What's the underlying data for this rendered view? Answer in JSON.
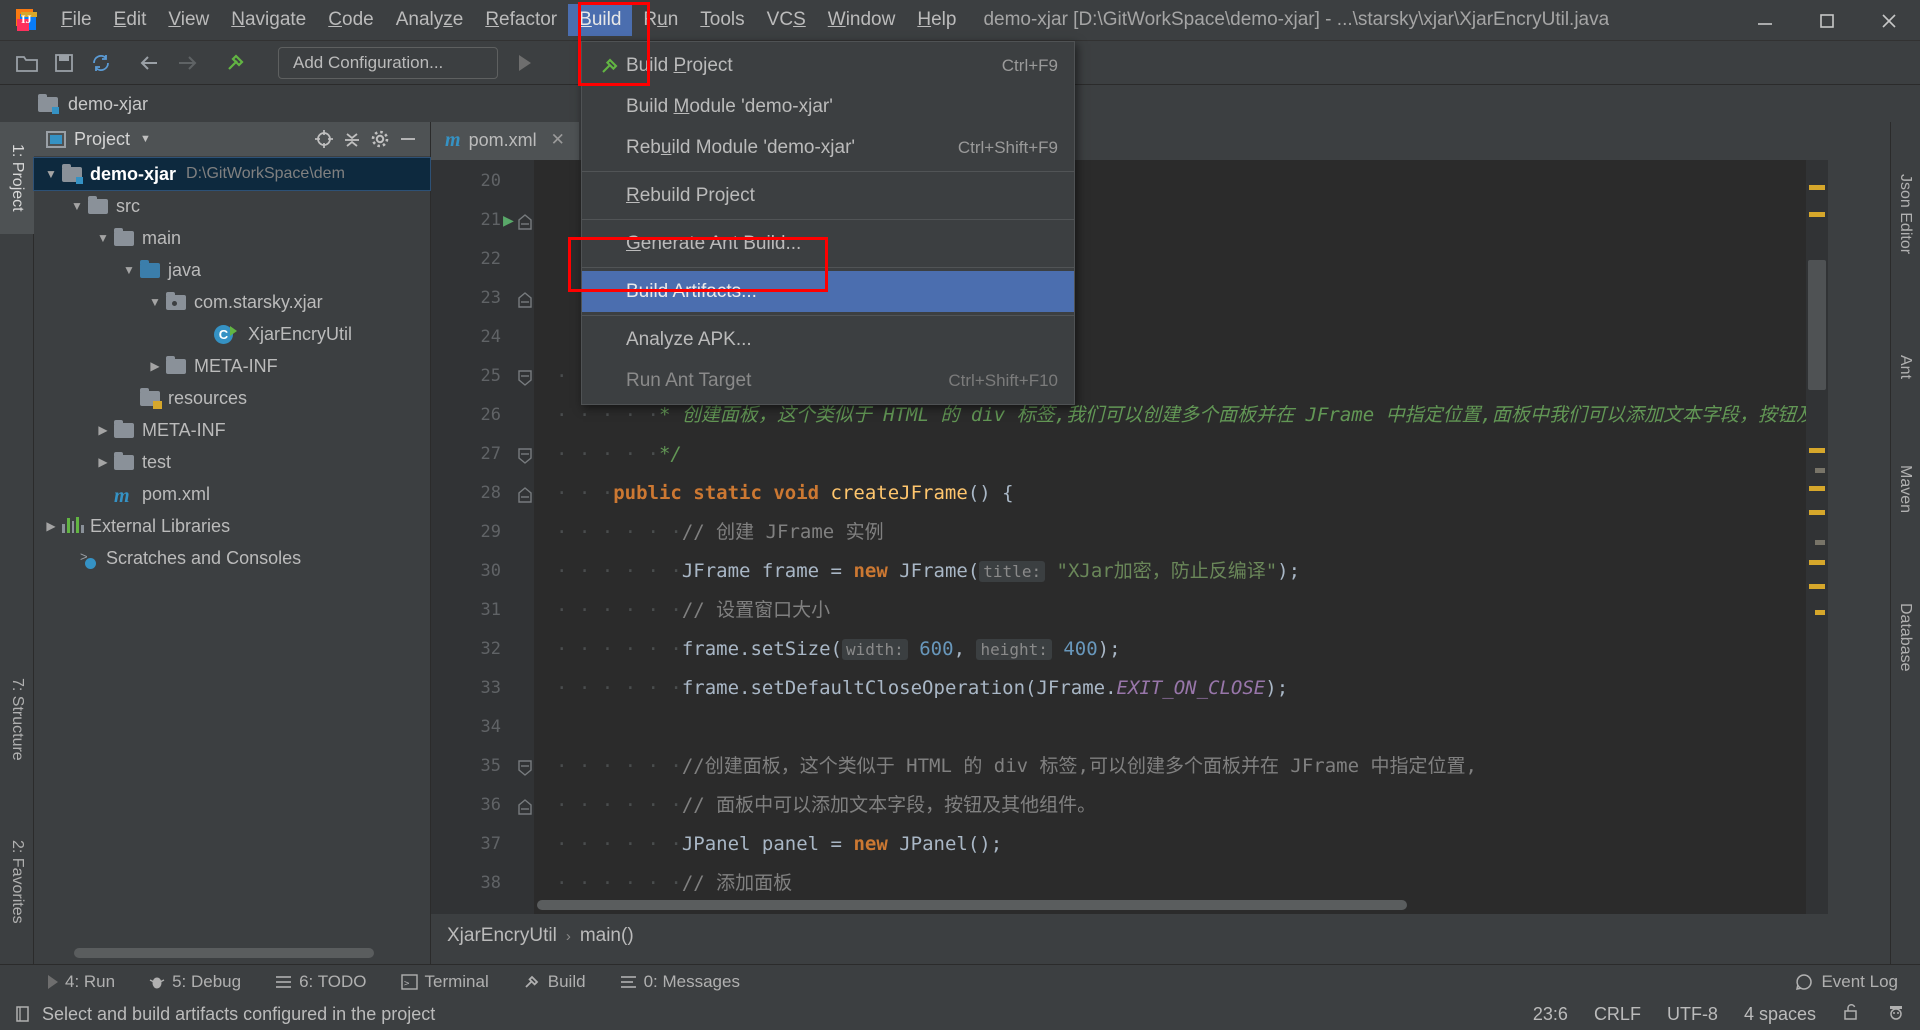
{
  "window": {
    "title": "demo-xjar [D:\\GitWorkSpace\\demo-xjar] - ...\\starsky\\xjar\\XjarEncryUtil.java",
    "minimize_icon": "minimize-icon",
    "maximize_icon": "maximize-icon",
    "close_icon": "close-icon"
  },
  "menubar": {
    "items": [
      {
        "label": "File",
        "mnemonic": "F"
      },
      {
        "label": "Edit",
        "mnemonic": "E"
      },
      {
        "label": "View",
        "mnemonic": "V"
      },
      {
        "label": "Navigate",
        "mnemonic": "N"
      },
      {
        "label": "Code",
        "mnemonic": "C"
      },
      {
        "label": "Analyze",
        "mnemonic": "z"
      },
      {
        "label": "Refactor",
        "mnemonic": "R"
      },
      {
        "label": "Build",
        "mnemonic": "B",
        "active": true
      },
      {
        "label": "Run",
        "mnemonic": "u"
      },
      {
        "label": "Tools",
        "mnemonic": "T"
      },
      {
        "label": "VCS",
        "mnemonic": "S"
      },
      {
        "label": "Window",
        "mnemonic": "W"
      },
      {
        "label": "Help",
        "mnemonic": "H"
      }
    ]
  },
  "build_menu": {
    "items": [
      {
        "label": "Build Project",
        "shortcut": "Ctrl+F9",
        "icon": "build-hammer-icon",
        "disabled": false,
        "highlighted": false
      },
      {
        "label": "Build Module 'demo-xjar'",
        "shortcut": "",
        "icon": "",
        "disabled": false,
        "highlighted": false
      },
      {
        "label": "Rebuild Module 'demo-xjar'",
        "shortcut": "Ctrl+Shift+F9",
        "icon": "",
        "disabled": false,
        "highlighted": false
      },
      {
        "separator_after": true,
        "label": "Rebuild Project",
        "shortcut": "",
        "icon": "",
        "disabled": false,
        "highlighted": false
      },
      {
        "label": "Generate Ant Build...",
        "shortcut": "",
        "icon": "",
        "disabled": false,
        "highlighted": false
      },
      {
        "label": "Build Artifacts...",
        "shortcut": "",
        "icon": "",
        "disabled": false,
        "highlighted": true
      },
      {
        "label": "Analyze APK...",
        "shortcut": "",
        "icon": "",
        "disabled": false,
        "highlighted": false
      },
      {
        "label": "Run Ant Target",
        "shortcut": "Ctrl+Shift+F10",
        "icon": "",
        "disabled": true,
        "highlighted": false
      }
    ]
  },
  "toolbar": {
    "open_icon": "open-folder-icon",
    "save_icon": "save-icon",
    "sync_icon": "sync-icon",
    "back_icon": "arrow-back-icon",
    "forward_icon": "arrow-forward-icon",
    "build_icon": "build-hammer-icon",
    "run_config_label": "Add Configuration...",
    "run_icon": "run-icon"
  },
  "project_breadcrumb": {
    "label": "demo-xjar"
  },
  "left_stripe": {
    "buttons": [
      {
        "label": "1: Project",
        "selected": true
      },
      {
        "label": "7: Structure",
        "selected": false
      },
      {
        "label": "2: Favorites",
        "selected": false
      }
    ]
  },
  "project_panel": {
    "title": "Project",
    "locate_icon": "locate-icon",
    "collapse_icon": "collapse-all-icon",
    "settings_icon": "gear-icon",
    "hide_icon": "minimize-icon",
    "tree": [
      {
        "label": "demo-xjar",
        "path": "D:\\GitWorkSpace\\dem",
        "indent": 0,
        "arrow": "down",
        "icon": "module-folder-icon",
        "selected": true
      },
      {
        "label": "src",
        "path": "",
        "indent": 1,
        "arrow": "down",
        "icon": "folder-icon"
      },
      {
        "label": "main",
        "path": "",
        "indent": 2,
        "arrow": "down",
        "icon": "folder-icon"
      },
      {
        "label": "java",
        "path": "",
        "indent": 3,
        "arrow": "down",
        "icon": "source-folder-icon"
      },
      {
        "label": "com.starsky.xjar",
        "path": "",
        "indent": 4,
        "arrow": "down",
        "icon": "package-icon"
      },
      {
        "label": "XjarEncryUtil",
        "path": "",
        "indent": 5,
        "arrow": "none",
        "icon": "java-class-icon"
      },
      {
        "label": "META-INF",
        "path": "",
        "indent": 4,
        "arrow": "right",
        "icon": "folder-icon"
      },
      {
        "label": "resources",
        "path": "",
        "indent": 3,
        "arrow": "none",
        "icon": "resources-folder-icon"
      },
      {
        "label": "META-INF",
        "path": "",
        "indent": 2,
        "arrow": "right",
        "icon": "folder-icon"
      },
      {
        "label": "test",
        "path": "",
        "indent": 2,
        "arrow": "right",
        "icon": "folder-icon"
      },
      {
        "label": "pom.xml",
        "path": "",
        "indent": 2,
        "arrow": "none",
        "icon": "maven-icon"
      },
      {
        "label": "External Libraries",
        "path": "",
        "indent": 0,
        "arrow": "right",
        "icon": "libraries-icon"
      },
      {
        "label": "Scratches and Consoles",
        "path": "",
        "indent": 0,
        "arrow": "none",
        "icon": "scratches-icon"
      }
    ]
  },
  "editor": {
    "tabs": [
      {
        "label": "pom.xml",
        "icon": "maven-icon",
        "active": true,
        "close_icon": "close-icon"
      }
    ],
    "first_line": 20,
    "lines": [
      {
        "num": 20,
        "tokens": []
      },
      {
        "num": 21,
        "tokens": [],
        "gutter": "run-icon",
        "fold": "fold-collapse"
      },
      {
        "num": 22,
        "tokens": []
      },
      {
        "num": 23,
        "tokens": [],
        "fold": "fold-collapse"
      },
      {
        "num": 24,
        "tokens": []
      },
      {
        "num": 25,
        "tokens": [
          {
            "t": "dots",
            "v": "· · · ·"
          },
          {
            "t": "jdoc",
            "v": "/**"
          }
        ],
        "fold": "fold-end"
      },
      {
        "num": 26,
        "tokens": [
          {
            "t": "dots",
            "v": "· · · · ·"
          },
          {
            "t": "jdoc",
            "v": "* 创建面板，这个类似于 HTML 的 div 标签,我们可以创建多个面板并在 JFrame 中指定位置,面板中我们可以添加文本字段，按钮及其他组"
          }
        ]
      },
      {
        "num": 27,
        "tokens": [
          {
            "t": "dots",
            "v": "· · · · ·"
          },
          {
            "t": "jdoc",
            "v": "*/"
          }
        ],
        "fold": "fold-end"
      },
      {
        "num": 28,
        "tokens": [
          {
            "t": "dots",
            "v": "· · ·"
          },
          {
            "t": "kw",
            "v": "public static void "
          },
          {
            "t": "mth",
            "v": "createJFrame"
          },
          {
            "t": "plain",
            "v": "() {"
          }
        ],
        "fold": "fold-collapse"
      },
      {
        "num": 29,
        "tokens": [
          {
            "t": "dots",
            "v": "· · · · · ·"
          },
          {
            "t": "cmt",
            "v": "// 创建 JFrame 实例"
          }
        ]
      },
      {
        "num": 30,
        "tokens": [
          {
            "t": "dots",
            "v": "· · · · · ·"
          },
          {
            "t": "plain",
            "v": "JFrame frame = "
          },
          {
            "t": "kw",
            "v": "new "
          },
          {
            "t": "plain",
            "v": "JFrame("
          },
          {
            "t": "param",
            "v": "title:"
          },
          {
            "t": "str",
            "v": " \"XJar加密，防止反编译\""
          },
          {
            "t": "plain",
            "v": ");"
          }
        ]
      },
      {
        "num": 31,
        "tokens": [
          {
            "t": "dots",
            "v": "· · · · · ·"
          },
          {
            "t": "cmt",
            "v": "// 设置窗口大小"
          }
        ]
      },
      {
        "num": 32,
        "tokens": [
          {
            "t": "dots",
            "v": "· · · · · ·"
          },
          {
            "t": "plain",
            "v": "frame.setSize("
          },
          {
            "t": "param",
            "v": "width:"
          },
          {
            "t": "num",
            "v": " 600"
          },
          {
            "t": "plain",
            "v": ", "
          },
          {
            "t": "param",
            "v": "height:"
          },
          {
            "t": "num",
            "v": " 400"
          },
          {
            "t": "plain",
            "v": ");"
          }
        ]
      },
      {
        "num": 33,
        "tokens": [
          {
            "t": "dots",
            "v": "· · · · · ·"
          },
          {
            "t": "plain",
            "v": "frame.setDefaultCloseOperation(JFrame."
          },
          {
            "t": "stat",
            "v": "EXIT_ON_CLOSE"
          },
          {
            "t": "plain",
            "v": ");"
          }
        ]
      },
      {
        "num": 34,
        "tokens": []
      },
      {
        "num": 35,
        "tokens": [
          {
            "t": "dots",
            "v": "· · · · · ·"
          },
          {
            "t": "cmt",
            "v": "//创建面板，这个类似于 HTML 的 div 标签,可以创建多个面板并在 JFrame 中指定位置,"
          }
        ],
        "fold": "fold-end"
      },
      {
        "num": 36,
        "tokens": [
          {
            "t": "dots",
            "v": "· · · · · ·"
          },
          {
            "t": "cmt",
            "v": "// 面板中可以添加文本字段，按钮及其他组件。"
          }
        ],
        "fold": "fold-collapse"
      },
      {
        "num": 37,
        "tokens": [
          {
            "t": "dots",
            "v": "· · · · · ·"
          },
          {
            "t": "plain",
            "v": "JPanel panel = "
          },
          {
            "t": "kw",
            "v": "new "
          },
          {
            "t": "plain",
            "v": "JPanel();"
          }
        ]
      },
      {
        "num": 38,
        "tokens": [
          {
            "t": "dots",
            "v": "· · · · · ·"
          },
          {
            "t": "cmt",
            "v": "// 添加面板"
          }
        ]
      }
    ]
  },
  "breadcrumb": {
    "class": "XjarEncryUtil",
    "method": "main()",
    "separator": "›"
  },
  "right_stripe": {
    "buttons": [
      {
        "label": "Json Editor",
        "icon": "json-icon"
      },
      {
        "label": "Ant",
        "icon": "ant-icon"
      },
      {
        "label": "Maven",
        "icon": "maven-icon"
      },
      {
        "label": "Database",
        "icon": "database-icon"
      }
    ]
  },
  "bottom_stripe": {
    "buttons": [
      {
        "label": "4: Run",
        "mnemonic": "4",
        "icon": "run-icon"
      },
      {
        "label": "5: Debug",
        "mnemonic": "5",
        "icon": "debug-icon"
      },
      {
        "label": "6: TODO",
        "mnemonic": "6",
        "icon": "todo-icon"
      },
      {
        "label": "Terminal",
        "mnemonic": "",
        "icon": "terminal-icon"
      },
      {
        "label": "Build",
        "mnemonic": "",
        "icon": "build-hammer-icon"
      },
      {
        "label": "0: Messages",
        "mnemonic": "0",
        "icon": "messages-icon"
      }
    ],
    "event_log": {
      "label": "Event Log",
      "icon": "event-log-icon"
    }
  },
  "statusbar": {
    "message": "Select and build artifacts configured in the project",
    "message_icon": "info-icon",
    "caret_position": "23:6",
    "line_separator": "CRLF",
    "encoding": "UTF-8",
    "indent": "4 spaces",
    "lock_icon": "unlock-icon",
    "inspector_icon": "inspector-icon"
  },
  "annotations": {
    "menu_build_highlight": "red-rectangle-build-menu",
    "build_artifacts_highlight": "red-rectangle-build-artifacts"
  }
}
